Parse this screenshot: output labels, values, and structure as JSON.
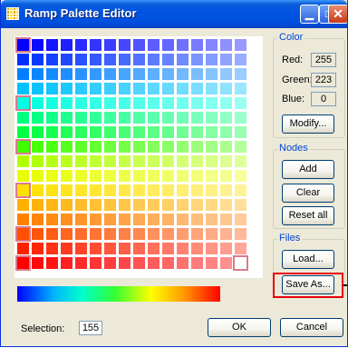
{
  "window": {
    "title": "Ramp Palette Editor",
    "close_glyph": "✕",
    "min_glyph": "▁",
    "max_glyph": "□"
  },
  "color_group": {
    "label": "Color",
    "red_label": "Red:",
    "red_value": "255",
    "green_label": "Green:",
    "green_value": "223",
    "blue_label": "Blue:",
    "blue_value": "0",
    "modify_button": "Modify..."
  },
  "nodes_group": {
    "label": "Nodes",
    "add_button": "Add",
    "clear_button": "Clear",
    "reset_button": "Reset all"
  },
  "files_group": {
    "label": "Files",
    "load_button": "Load...",
    "save_as_button": "Save As..."
  },
  "selection": {
    "label": "Selection:",
    "value": "155"
  },
  "footer": {
    "ok_button": "OK",
    "cancel_button": "Cancel"
  },
  "palette": {
    "rows": 16,
    "cols": 16,
    "colors_per_row": [
      "#0000ff",
      "#0030ff",
      "#0080ff",
      "#00c0ff",
      "#00ffe0",
      "#00ff80",
      "#00ff40",
      "#40ff00",
      "#b0ff00",
      "#e8ff00",
      "#ffe000",
      "#ffb000",
      "#ff8000",
      "#ff5000",
      "#ff2000",
      "#ff0000"
    ],
    "node_cells": [
      0,
      64,
      112,
      160,
      208,
      240
    ],
    "selected_cell": 255
  }
}
